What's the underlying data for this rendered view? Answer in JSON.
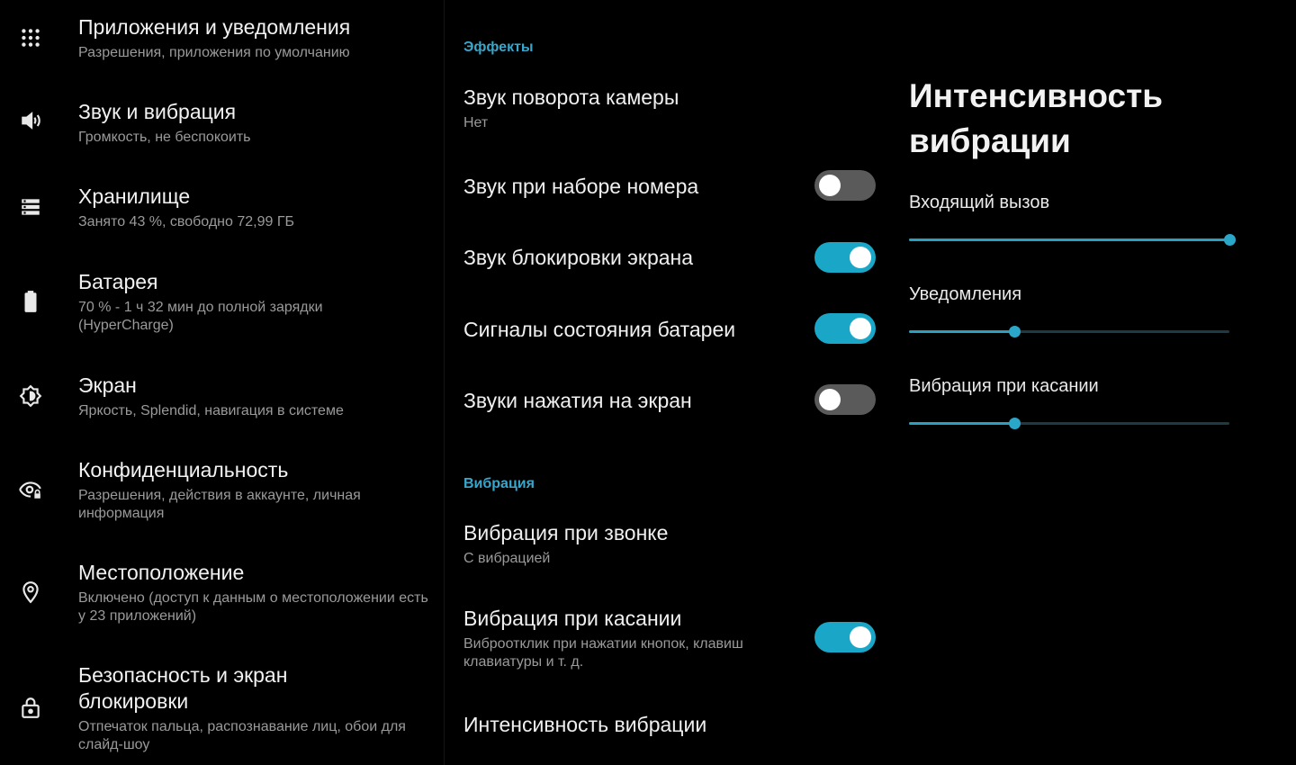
{
  "left_menu": [
    {
      "title": "Приложения и уведомления",
      "subtitle": "Разрешения, приложения по умолчанию",
      "icon": "apps-grid-icon"
    },
    {
      "title": "Звук и вибрация",
      "subtitle": "Громкость, не беспокоить",
      "icon": "speaker-icon"
    },
    {
      "title": "Хранилище",
      "subtitle": "Занято 43 %, свободно 72,99 ГБ",
      "icon": "storage-icon"
    },
    {
      "title": "Батарея",
      "subtitle": "70 % - 1 ч 32 мин до полной зарядки (HyperCharge)",
      "icon": "battery-icon"
    },
    {
      "title": "Экран",
      "subtitle": "Яркость, Splendid, навигация в системе",
      "icon": "brightness-icon"
    },
    {
      "title": "Конфиденциальность",
      "subtitle": "Разрешения, действия в аккаунте, личная информация",
      "icon": "privacy-eye-icon"
    },
    {
      "title": "Местоположение",
      "subtitle": "Включено (доступ к данным о местоположении есть у 23 приложений)",
      "icon": "location-pin-icon"
    },
    {
      "title": "Безопасность и экран блокировки",
      "subtitle": "Отпечаток пальца, распознавание лиц, обои для слайд-шоу",
      "icon": "lock-icon"
    }
  ],
  "middle": {
    "effects_header": "Эффекты",
    "camera_sound": {
      "title": "Звук поворота камеры",
      "value": "Нет"
    },
    "dial_sound": {
      "title": "Звук при наборе номера",
      "on": false
    },
    "lock_sound": {
      "title": "Звук блокировки экрана",
      "on": true
    },
    "battery_signals": {
      "title": "Сигналы состояния батареи",
      "on": true
    },
    "touch_sounds": {
      "title": "Звуки нажатия на экран",
      "on": false
    },
    "vibration_header": "Вибрация",
    "ring_vibration": {
      "title": "Вибрация при звонке",
      "value": "С вибрацией"
    },
    "touch_vibration": {
      "title": "Вибрация при касании",
      "subtitle": "Виброотклик при нажатии кнопок, клавиш клавиатуры и т. д.",
      "on": true
    },
    "vibration_intensity": {
      "title": "Интенсивность вибрации"
    }
  },
  "right_panel": {
    "title": "Интенсивность вибрации",
    "sliders": [
      {
        "label": "Входящий вызов",
        "fraction": 1.0
      },
      {
        "label": "Уведомления",
        "fraction": 0.33
      },
      {
        "label": "Вибрация при касании",
        "fraction": 0.33
      }
    ]
  },
  "colors": {
    "accent": "#1aa6c7",
    "header": "#38a7cc",
    "background": "#000000"
  }
}
